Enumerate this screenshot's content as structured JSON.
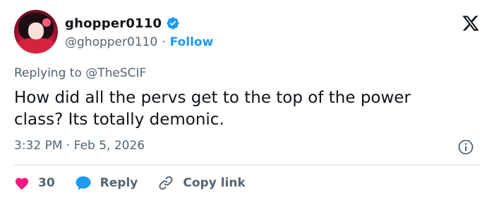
{
  "author": {
    "display_name": "ghopper0110",
    "handle": "@ghopper0110",
    "separator": "·",
    "follow_label": "Follow"
  },
  "reply": {
    "prefix": "Replying to",
    "mention": "@TheSCIF"
  },
  "tweet": {
    "text_line1": "How did all the pervs get to the top of the power",
    "text_line2": "class? Its totally demonic.",
    "time": "3:32 PM",
    "separator": "·",
    "date": "Feb 5, 2026"
  },
  "actions": {
    "like_count": "30",
    "reply_label": "Reply",
    "copy_link_label": "Copy link"
  },
  "colors": {
    "accent": "#1d9bf0",
    "like": "#f91880",
    "muted": "#536471",
    "text": "#0f1419",
    "divider": "#cfd9de"
  },
  "icons": [
    "verified-badge-icon",
    "x-logo-icon",
    "info-icon",
    "heart-icon",
    "reply-bubble-icon",
    "link-icon"
  ]
}
